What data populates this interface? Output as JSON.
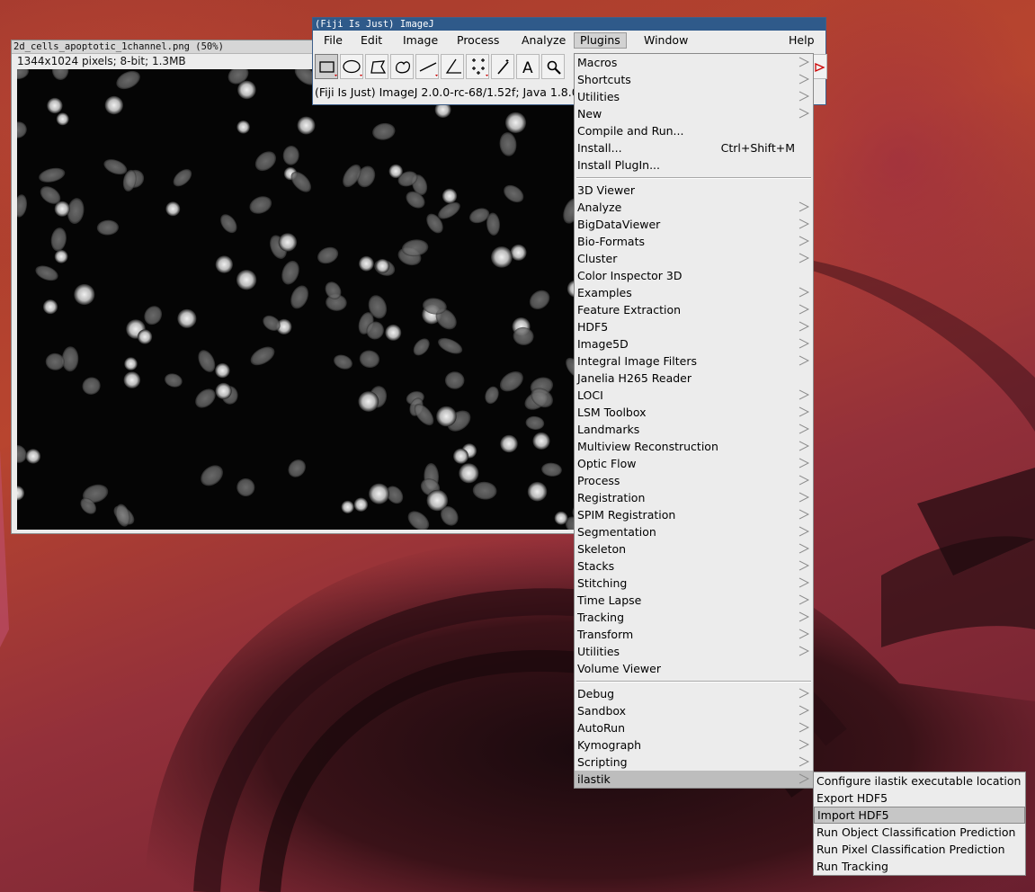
{
  "image_window": {
    "title": "2d_cells_apoptotic_1channel.png (50%)",
    "info": "1344x1024 pixels; 8-bit; 1.3MB"
  },
  "imagej_window": {
    "title": "(Fiji Is Just) ImageJ",
    "menus": [
      "File",
      "Edit",
      "Image",
      "Process",
      "Analyze",
      "Plugins",
      "Window",
      "Help"
    ],
    "active_menu": "Plugins",
    "tools": [
      "rectangle-tool",
      "oval-tool",
      "polygon-tool",
      "freehand-tool",
      "line-tool",
      "angle-tool",
      "point-tool",
      "wand-tool",
      "text-tool",
      "zoom-tool"
    ],
    "status": "(Fiji Is Just) ImageJ 2.0.0-rc-68/1.52f; Java 1.8.0"
  },
  "plugins_menu": {
    "group1": [
      {
        "label": "Macros",
        "submenu": true
      },
      {
        "label": "Shortcuts",
        "submenu": true
      },
      {
        "label": "Utilities",
        "submenu": true
      },
      {
        "label": "New",
        "submenu": true
      },
      {
        "label": "Compile and Run...",
        "submenu": false
      },
      {
        "label": "Install...",
        "submenu": false,
        "accel": "Ctrl+Shift+M"
      },
      {
        "label": "Install PlugIn...",
        "submenu": false
      }
    ],
    "group2": [
      {
        "label": "3D Viewer",
        "submenu": false
      },
      {
        "label": "Analyze",
        "submenu": true
      },
      {
        "label": "BigDataViewer",
        "submenu": true
      },
      {
        "label": "Bio-Formats",
        "submenu": true
      },
      {
        "label": "Cluster",
        "submenu": true
      },
      {
        "label": "Color Inspector 3D",
        "submenu": false
      },
      {
        "label": "Examples",
        "submenu": true
      },
      {
        "label": "Feature Extraction",
        "submenu": true
      },
      {
        "label": "HDF5",
        "submenu": true
      },
      {
        "label": "Image5D",
        "submenu": true
      },
      {
        "label": "Integral Image Filters",
        "submenu": true
      },
      {
        "label": "Janelia H265 Reader",
        "submenu": false
      },
      {
        "label": "LOCI",
        "submenu": true
      },
      {
        "label": "LSM Toolbox",
        "submenu": true
      },
      {
        "label": "Landmarks",
        "submenu": true
      },
      {
        "label": "Multiview Reconstruction",
        "submenu": true
      },
      {
        "label": "Optic Flow",
        "submenu": true
      },
      {
        "label": "Process",
        "submenu": true
      },
      {
        "label": "Registration",
        "submenu": true
      },
      {
        "label": "SPIM Registration",
        "submenu": true
      },
      {
        "label": "Segmentation",
        "submenu": true
      },
      {
        "label": "Skeleton",
        "submenu": true
      },
      {
        "label": "Stacks",
        "submenu": true
      },
      {
        "label": "Stitching",
        "submenu": true
      },
      {
        "label": "Time Lapse",
        "submenu": true
      },
      {
        "label": "Tracking",
        "submenu": true
      },
      {
        "label": "Transform",
        "submenu": true
      },
      {
        "label": "Utilities",
        "submenu": true
      },
      {
        "label": "Volume Viewer",
        "submenu": false
      }
    ],
    "group3": [
      {
        "label": "Debug",
        "submenu": true
      },
      {
        "label": "Sandbox",
        "submenu": true
      },
      {
        "label": "AutoRun",
        "submenu": true
      },
      {
        "label": "Kymograph",
        "submenu": true
      },
      {
        "label": "Scripting",
        "submenu": true
      },
      {
        "label": "ilastik",
        "submenu": true,
        "highlighted": true
      }
    ]
  },
  "ilastik_menu": [
    {
      "label": "Configure ilastik executable location"
    },
    {
      "label": "Export HDF5"
    },
    {
      "label": "Import HDF5",
      "highlighted": true
    },
    {
      "label": "Run Object Classification Prediction"
    },
    {
      "label": "Run Pixel Classification Prediction"
    },
    {
      "label": "Run Tracking"
    }
  ],
  "colors": {
    "menu_bg": "#ececec",
    "highlight": "#bdbdbd",
    "imagej_title": "#2f5a8a",
    "nuclei": "#9a9a9a"
  }
}
